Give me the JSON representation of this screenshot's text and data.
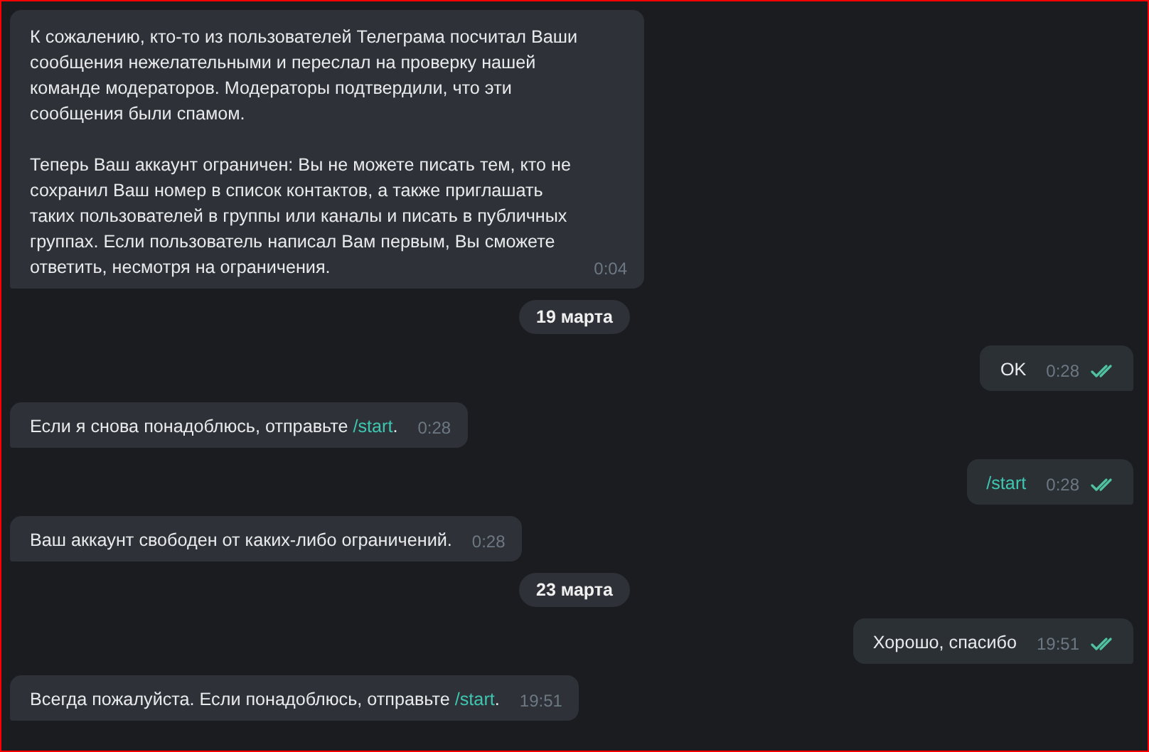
{
  "messages": [
    {
      "kind": "incoming",
      "paragraphs": [
        [
          {
            "text": "К сожалению, кто-то из пользователей Телеграма посчитал Ваши сообщения нежелательными и переслал на проверку нашей команде модераторов. Модераторы подтвердили, что эти сообщения были спамом."
          }
        ],
        [
          {
            "text": "Теперь Ваш аккаунт ограничен: Вы не можете писать тем, кто не сохранил Ваш номер в список контактов, а также приглашать таких пользователей в группы или каналы и писать в публичных группах. Если пользователь написал Вам первым, Вы сможете ответить, несмотря на ограничения."
          }
        ]
      ],
      "time": "0:04"
    },
    {
      "kind": "date",
      "text": "19 марта"
    },
    {
      "kind": "outgoing",
      "paragraphs": [
        [
          {
            "text": "OK"
          }
        ]
      ],
      "time": "0:28",
      "read": true
    },
    {
      "kind": "incoming",
      "paragraphs": [
        [
          {
            "text": "Если я снова понадоблюсь, отправьте "
          },
          {
            "text": "/start",
            "kind": "command"
          },
          {
            "text": "."
          }
        ]
      ],
      "time": "0:28"
    },
    {
      "kind": "outgoing",
      "paragraphs": [
        [
          {
            "text": "/start",
            "kind": "command"
          }
        ]
      ],
      "time": "0:28",
      "read": true
    },
    {
      "kind": "incoming",
      "paragraphs": [
        [
          {
            "text": "Ваш аккаунт свободен от каких-либо ограничений."
          }
        ]
      ],
      "time": "0:28"
    },
    {
      "kind": "date",
      "text": "23 марта"
    },
    {
      "kind": "outgoing",
      "paragraphs": [
        [
          {
            "text": "Хорошо, спасибо"
          }
        ]
      ],
      "time": "19:51",
      "read": true
    },
    {
      "kind": "incoming",
      "paragraphs": [
        [
          {
            "text": "Всегда пожалуйста. Если понадоблюсь, отправьте "
          },
          {
            "text": "/start",
            "kind": "command"
          },
          {
            "text": "."
          }
        ]
      ],
      "time": "19:51"
    }
  ]
}
